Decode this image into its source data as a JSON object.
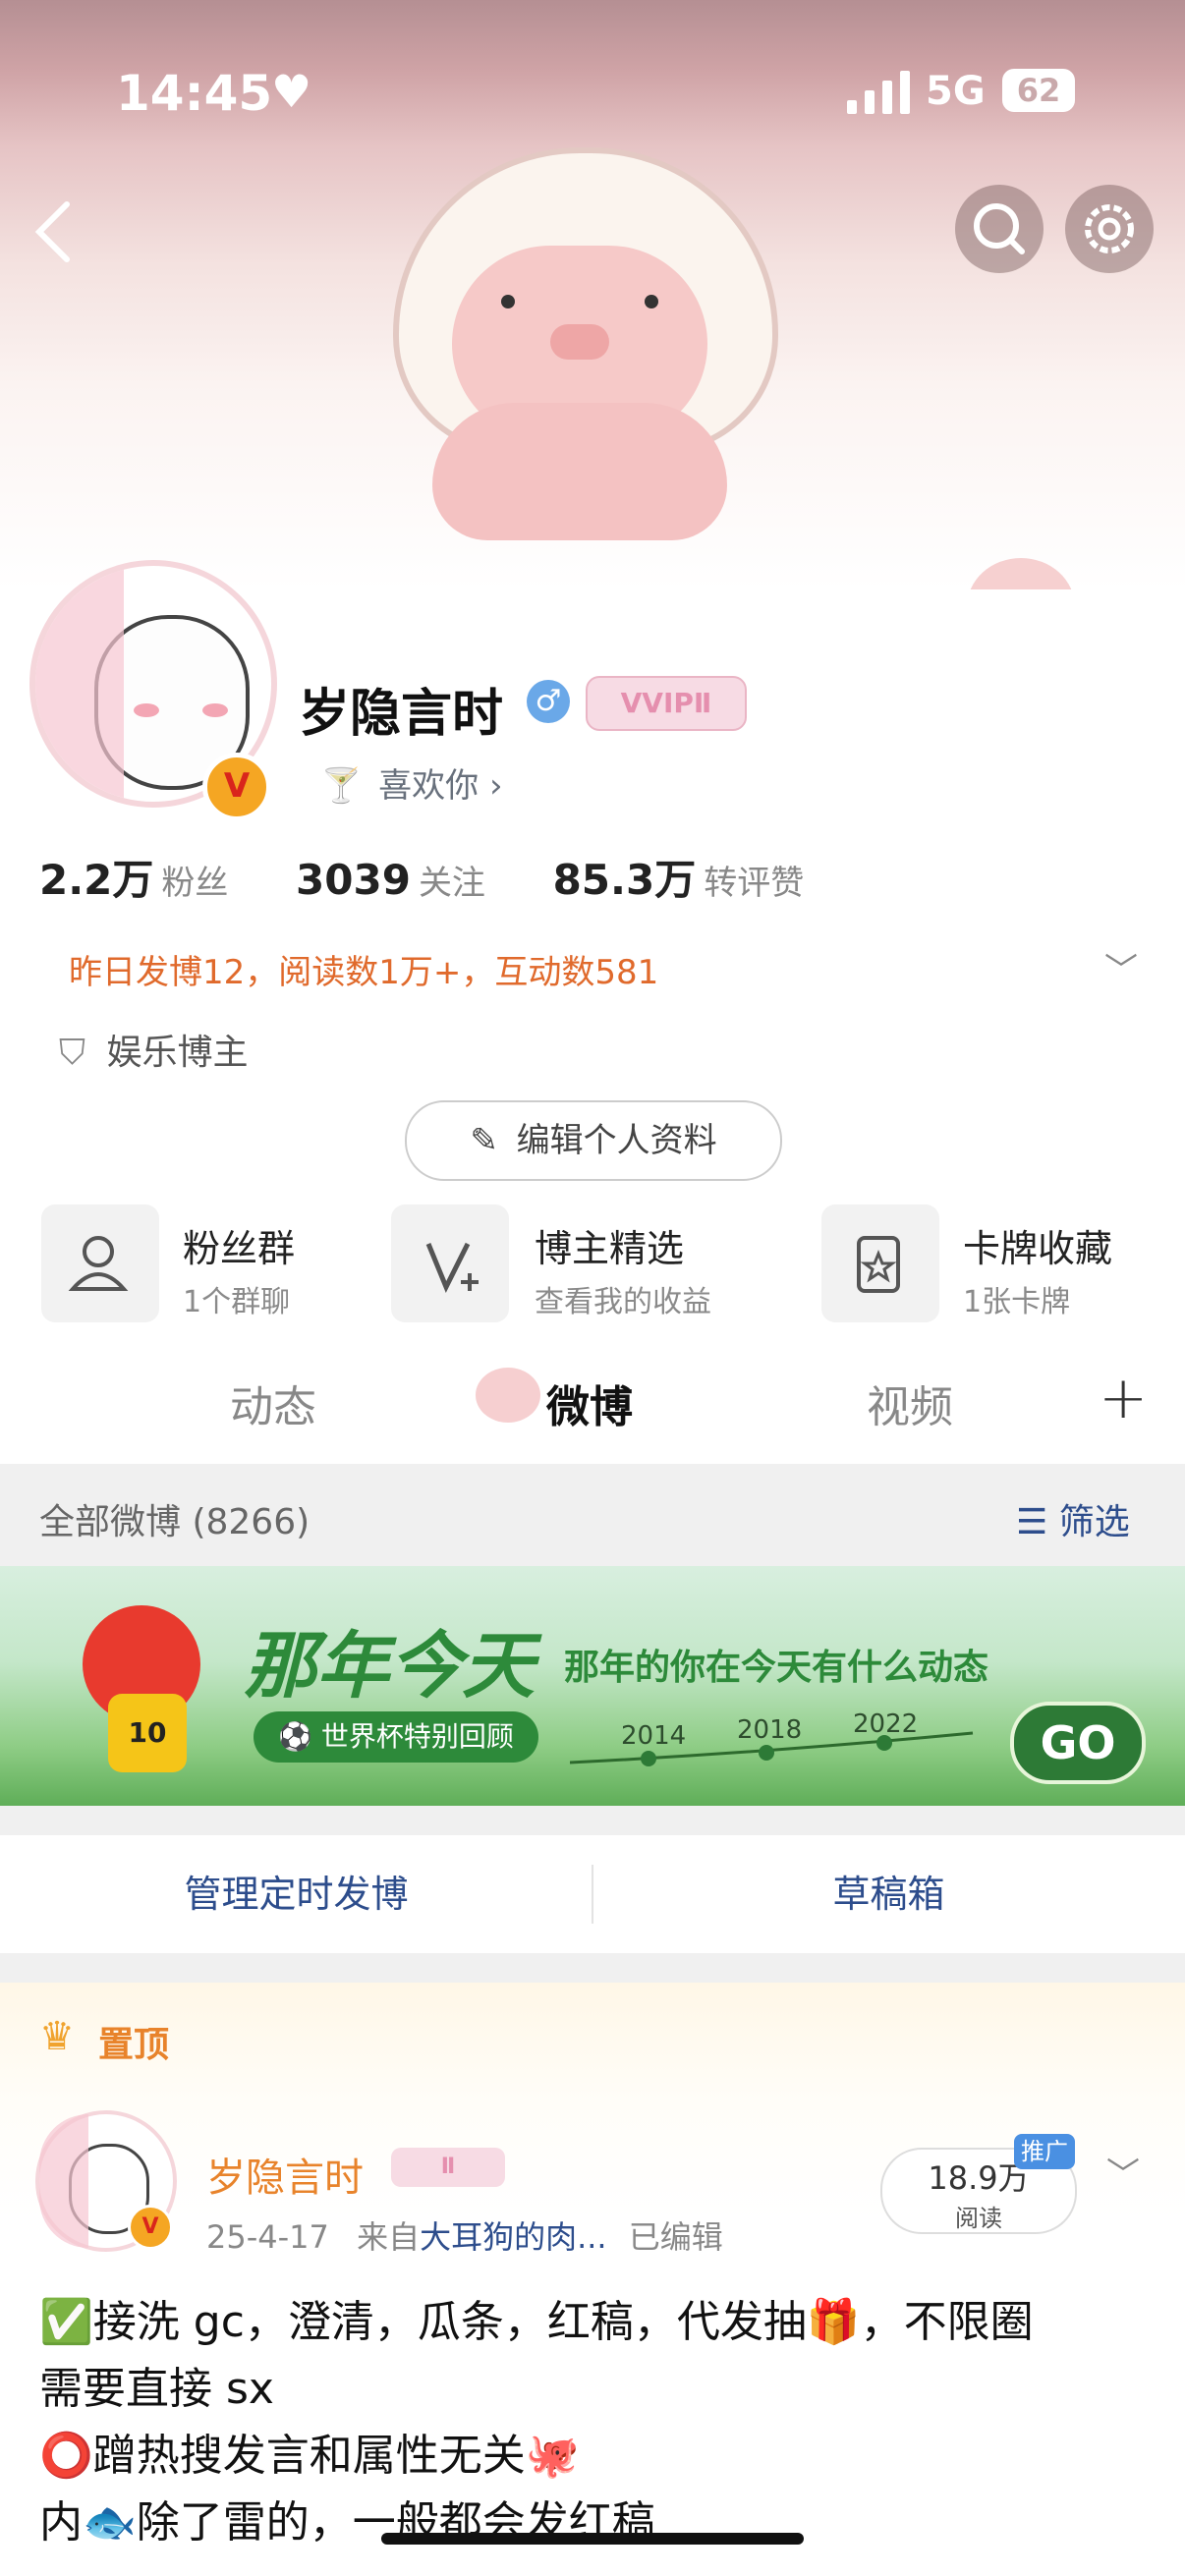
{
  "status": {
    "time": "14:45",
    "network": "5G",
    "battery": "62"
  },
  "profile": {
    "name": "岁隐言时",
    "vip_badge": "VVIPⅡ",
    "like_text": "喜欢你 ›",
    "stats": [
      {
        "value": "2.2万",
        "label": "粉丝"
      },
      {
        "value": "3039",
        "label": "关注"
      },
      {
        "value": "85.3万",
        "label": "转评赞"
      }
    ],
    "yesterday": "昨日发博12，阅读数1万+，互动数581",
    "tag": "娱乐博主",
    "edit_label": "编辑个人资料"
  },
  "tiles": [
    {
      "title": "粉丝群",
      "sub": "1个群聊",
      "icon": "group-icon"
    },
    {
      "title": "博主精选",
      "sub": "查看我的收益",
      "icon": "v-plus-icon"
    },
    {
      "title": "卡牌收藏",
      "sub": "1张卡牌",
      "icon": "card-icon"
    }
  ],
  "tabs": [
    "动态",
    "微博",
    "视频"
  ],
  "feed": {
    "all_label": "全部微博 (8266)",
    "filter_label": "筛选"
  },
  "banner": {
    "title": "那年今天",
    "subtitle": "那年的你在今天有什么动态",
    "pill": "⚽ 世界杯特别回顾",
    "years": [
      "2014",
      "2018",
      "2022"
    ],
    "go": "GO",
    "jersey": "10"
  },
  "actions": {
    "schedule": "管理定时发博",
    "drafts": "草稿箱"
  },
  "pinned": {
    "label": "置顶",
    "name": "岁隐言时",
    "vip": "Ⅱ",
    "date": "25-4-17",
    "from": "来自",
    "source": "大耳狗的肉...",
    "edited": "已编辑",
    "reads_value": "18.9万",
    "reads_label": "阅读",
    "promo": "推广",
    "lines": [
      "✅接洗 gc，澄清，瓜条，红稿，代发抽🎁，不限圈",
      "需要直接 sx",
      "⭕蹭热搜发言和属性无关🐙",
      "内🐟除了雷的，一般都会发红稿"
    ]
  }
}
